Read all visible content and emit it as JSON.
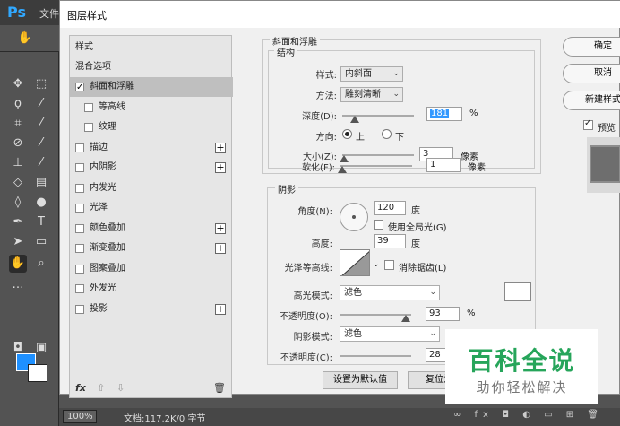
{
  "app": {
    "logo": "Ps",
    "menu_partial": "文件"
  },
  "dialog": {
    "title": "图层样式"
  },
  "style_list": {
    "header": "样式",
    "blending": "混合选项",
    "items": [
      {
        "label": "斜面和浮雕",
        "checked": true,
        "selected": true,
        "has_plus": false,
        "indent": false
      },
      {
        "label": "等高线",
        "checked": false,
        "selected": false,
        "has_plus": false,
        "indent": true
      },
      {
        "label": "纹理",
        "checked": false,
        "selected": false,
        "has_plus": false,
        "indent": true
      },
      {
        "label": "描边",
        "checked": false,
        "selected": false,
        "has_plus": true,
        "indent": false
      },
      {
        "label": "内阴影",
        "checked": false,
        "selected": false,
        "has_plus": true,
        "indent": false
      },
      {
        "label": "内发光",
        "checked": false,
        "selected": false,
        "has_plus": false,
        "indent": false
      },
      {
        "label": "光泽",
        "checked": false,
        "selected": false,
        "has_plus": false,
        "indent": false
      },
      {
        "label": "颜色叠加",
        "checked": false,
        "selected": false,
        "has_plus": true,
        "indent": false
      },
      {
        "label": "渐变叠加",
        "checked": false,
        "selected": false,
        "has_plus": true,
        "indent": false
      },
      {
        "label": "图案叠加",
        "checked": false,
        "selected": false,
        "has_plus": false,
        "indent": false
      },
      {
        "label": "外发光",
        "checked": false,
        "selected": false,
        "has_plus": false,
        "indent": false
      },
      {
        "label": "投影",
        "checked": false,
        "selected": false,
        "has_plus": true,
        "indent": false
      }
    ],
    "footer": {
      "fx": "fx",
      "up": "⇧",
      "down": "⇩",
      "trash": "🗑"
    }
  },
  "bevel": {
    "section_title": "斜面和浮雕",
    "structure_title": "结构",
    "style_label": "样式:",
    "style_value": "内斜面",
    "technique_label": "方法:",
    "technique_value": "雕刻清晰",
    "depth_label": "深度(D):",
    "depth_value": "181",
    "depth_unit": "%",
    "depth_level": 0.18,
    "direction_label": "方向:",
    "direction_up": "上",
    "direction_down": "下",
    "size_label": "大小(Z):",
    "size_value": "3",
    "size_unit": "像素",
    "size_level": 0.03,
    "soften_label": "软化(F):",
    "soften_value": "1",
    "soften_unit": "像素",
    "soften_level": 0.02
  },
  "shading": {
    "title": "阴影",
    "angle_label": "角度(N):",
    "angle_value": "120",
    "angle_unit": "度",
    "global_light_label": "使用全局光(G)",
    "altitude_label": "高度:",
    "altitude_value": "39",
    "altitude_unit": "度",
    "gloss_label": "光泽等高线:",
    "antialias_label": "消除锯齿(L)",
    "highlight_mode_label": "高光模式:",
    "highlight_mode_value": "滤色",
    "highlight_opacity_label": "不透明度(O):",
    "highlight_opacity_value": "93",
    "highlight_opacity_unit": "%",
    "highlight_opacity_level": 0.93,
    "shadow_mode_label": "阴影模式:",
    "shadow_mode_value": "滤色",
    "shadow_opacity_label": "不透明度(C):",
    "shadow_opacity_value": "28"
  },
  "buttons": {
    "make_default": "设置为默认值",
    "reset_default": "复位为",
    "ok": "确定",
    "cancel": "取消",
    "new_style": "新建样式",
    "preview": "预览"
  },
  "status": {
    "zoom": "100%",
    "doc": "文档:117.2K/0 字节"
  },
  "watermark": {
    "title": "百科全说",
    "subtitle": "助你轻松解决"
  },
  "colors": {
    "foreground": "#1e90ff",
    "background": "#ffffff",
    "watermark_green": "#26a55a"
  }
}
